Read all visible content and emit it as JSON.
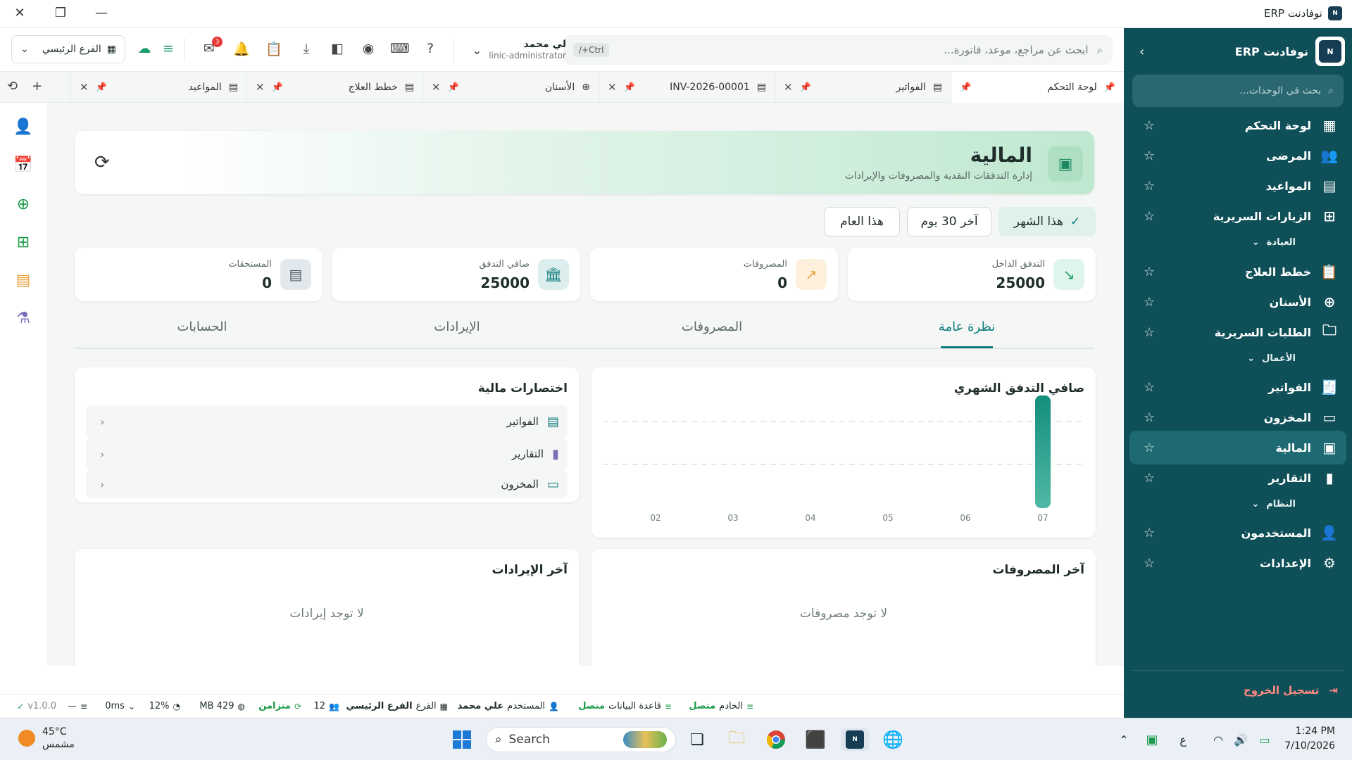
{
  "window": {
    "title": "نوفادنت ERP",
    "logo_text": "N"
  },
  "sidebar": {
    "title": "نوفادنت ERP",
    "search_placeholder": "بحث في الوحدات...",
    "items": [
      {
        "label": "لوحة التحكم",
        "icon": "dashboard-icon"
      },
      {
        "label": "المرضى",
        "icon": "users-icon"
      },
      {
        "label": "المواعيد",
        "icon": "calendar-icon"
      },
      {
        "label": "الزيارات السريرية",
        "icon": "plus-square-icon"
      },
      {
        "label": "خطط العلاج",
        "icon": "clipboard-icon"
      },
      {
        "label": "الأسنان",
        "icon": "medical-bag-icon"
      },
      {
        "label": "الطلبات السريرية",
        "icon": "folder-icon"
      },
      {
        "label": "الفواتير",
        "icon": "receipt-icon"
      },
      {
        "label": "المخزون",
        "icon": "archive-icon"
      },
      {
        "label": "المالية",
        "icon": "wallet-icon"
      },
      {
        "label": "التقارير",
        "icon": "bar-chart-icon"
      },
      {
        "label": "المستخدمون",
        "icon": "user-cog-icon"
      },
      {
        "label": "الإعدادات",
        "icon": "gear-icon"
      }
    ],
    "sections": {
      "clinic": "العيادة",
      "business": "الأعمال",
      "system": "النظام"
    },
    "logout": "تسجيل الخروج",
    "active": "المالية"
  },
  "toolbar": {
    "search_placeholder": "ابحث عن مراجع، موعد، فاتورة...",
    "shortcut": "Ctrl+/",
    "user_name": "لي محمد",
    "user_role": "clinic-administrator",
    "mail_badge": "3",
    "branch": "الفرع الرئيسي"
  },
  "tabs": [
    {
      "label": "لوحة التحكم",
      "active": true
    },
    {
      "label": "الفواتير"
    },
    {
      "label": "INV-2026-00001"
    },
    {
      "label": "الأسنان"
    },
    {
      "label": "خطط العلاج"
    },
    {
      "label": "المواعيد"
    }
  ],
  "page": {
    "title": "المالية",
    "subtitle": "إدارة التدفقات النقدية والمصروفات والإيرادات",
    "periods": [
      "هذا الشهر",
      "آخر 30 يوم",
      "هذا العام"
    ],
    "kpis": [
      {
        "label": "التدفق الداخل",
        "value": "25000",
        "color": "#1c9b6a"
      },
      {
        "label": "المصروفات",
        "value": "0",
        "color": "#e8a23a"
      },
      {
        "label": "صافي التدفق",
        "value": "25000",
        "color": "#0e7c7b"
      },
      {
        "label": "المستحقات",
        "value": "0",
        "color": "#4a5a68"
      }
    ],
    "tabs": [
      "نظرة عامة",
      "المصروفات",
      "الإيرادات",
      "الحسابات"
    ],
    "chart_title": "صافي التدفق الشهري",
    "shortcuts_title": "اختصارات مالية",
    "shortcuts": [
      "الفواتير",
      "التقارير",
      "المخزون"
    ],
    "latest_expenses_title": "آخر المصروفات",
    "latest_expenses_empty": "لا توجد مصروفات",
    "latest_revenue_title": "آخر الإيرادات",
    "latest_revenue_empty": "لا توجد إيرادات"
  },
  "chart_data": {
    "type": "bar",
    "title": "صافي التدفق الشهري",
    "categories": [
      "02",
      "03",
      "04",
      "05",
      "06",
      "07"
    ],
    "values": [
      0,
      0,
      0,
      0,
      0,
      25000
    ],
    "ylim": [
      0,
      25000
    ],
    "grid": true,
    "color": "#1c9b8a"
  },
  "statusbar": {
    "server_label": "الخادم",
    "server_value": "متصل",
    "db_label": "قاعدة البيانات",
    "db_value": "متصل",
    "user_label": "المستخدم",
    "user_value": "علي محمد",
    "branch_label": "الفرع",
    "branch_value": "الفرع الرئيسي",
    "count": "12",
    "sync": "متزامن",
    "memory": "429 MB",
    "cpu": "12%",
    "latency": "0ms",
    "version": "v1.0.0"
  },
  "taskbar": {
    "weather_temp": "45°C",
    "weather_desc": "مشمس",
    "search": "Search",
    "time": "1:24 PM",
    "date": "7/10/2026",
    "lang": "ع"
  }
}
